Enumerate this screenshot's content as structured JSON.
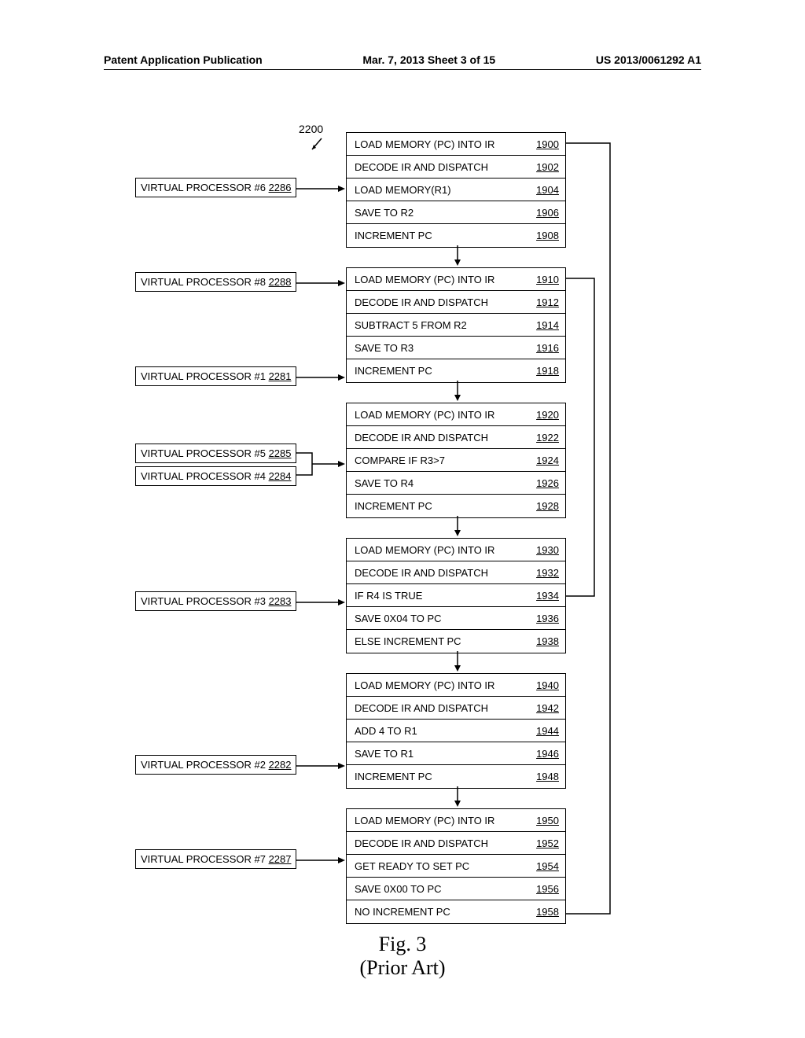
{
  "header": {
    "left": "Patent Application Publication",
    "center": "Mar. 7, 2013  Sheet 3 of 15",
    "right": "US 2013/0061292 A1"
  },
  "ref_2200": "2200",
  "vps": [
    {
      "label": "VIRTUAL PROCESSOR #6",
      "num": "2286"
    },
    {
      "label": "VIRTUAL PROCESSOR #8",
      "num": "2288"
    },
    {
      "label": "VIRTUAL PROCESSOR #1",
      "num": "2281"
    },
    {
      "label": "VIRTUAL PROCESSOR #5",
      "num": "2285"
    },
    {
      "label": "VIRTUAL PROCESSOR #4",
      "num": "2284"
    },
    {
      "label": "VIRTUAL PROCESSOR #3",
      "num": "2283"
    },
    {
      "label": "VIRTUAL PROCESSOR #2",
      "num": "2282"
    },
    {
      "label": "VIRTUAL PROCESSOR #7",
      "num": "2287"
    }
  ],
  "blocks": [
    [
      {
        "text": "LOAD MEMORY (PC) INTO IR",
        "num": "1900"
      },
      {
        "text": "DECODE IR AND DISPATCH",
        "num": "1902"
      },
      {
        "text": "LOAD MEMORY(R1)",
        "num": "1904"
      },
      {
        "text": "SAVE TO R2",
        "num": "1906"
      },
      {
        "text": "INCREMENT PC",
        "num": "1908"
      }
    ],
    [
      {
        "text": "LOAD MEMORY (PC) INTO IR",
        "num": "1910"
      },
      {
        "text": "DECODE IR AND DISPATCH",
        "num": "1912"
      },
      {
        "text": "SUBTRACT 5 FROM R2",
        "num": "1914"
      },
      {
        "text": "SAVE TO R3",
        "num": "1916"
      },
      {
        "text": "INCREMENT PC",
        "num": "1918"
      }
    ],
    [
      {
        "text": "LOAD MEMORY (PC) INTO IR",
        "num": "1920"
      },
      {
        "text": "DECODE IR AND DISPATCH",
        "num": "1922"
      },
      {
        "text": "COMPARE IF R3>7",
        "num": "1924"
      },
      {
        "text": "SAVE TO R4",
        "num": "1926"
      },
      {
        "text": "INCREMENT PC",
        "num": "1928"
      }
    ],
    [
      {
        "text": "LOAD MEMORY (PC) INTO IR",
        "num": "1930"
      },
      {
        "text": "DECODE IR AND DISPATCH",
        "num": "1932"
      },
      {
        "text": "IF R4 IS TRUE",
        "num": "1934"
      },
      {
        "text": "SAVE 0X04 TO PC",
        "num": "1936"
      },
      {
        "text": "ELSE INCREMENT PC",
        "num": "1938"
      }
    ],
    [
      {
        "text": "LOAD MEMORY (PC) INTO IR",
        "num": "1940"
      },
      {
        "text": "DECODE IR AND DISPATCH",
        "num": "1942"
      },
      {
        "text": "ADD 4 TO R1",
        "num": "1944"
      },
      {
        "text": "SAVE TO R1",
        "num": "1946"
      },
      {
        "text": "INCREMENT PC",
        "num": "1948"
      }
    ],
    [
      {
        "text": "LOAD MEMORY (PC) INTO IR",
        "num": "1950"
      },
      {
        "text": "DECODE IR AND DISPATCH",
        "num": "1952"
      },
      {
        "text": "GET READY TO SET PC",
        "num": "1954"
      },
      {
        "text": "SAVE 0X00 TO PC",
        "num": "1956"
      },
      {
        "text": "NO INCREMENT PC",
        "num": "1958"
      }
    ]
  ],
  "figure_caption_1": "Fig. 3",
  "figure_caption_2": "(Prior Art)"
}
